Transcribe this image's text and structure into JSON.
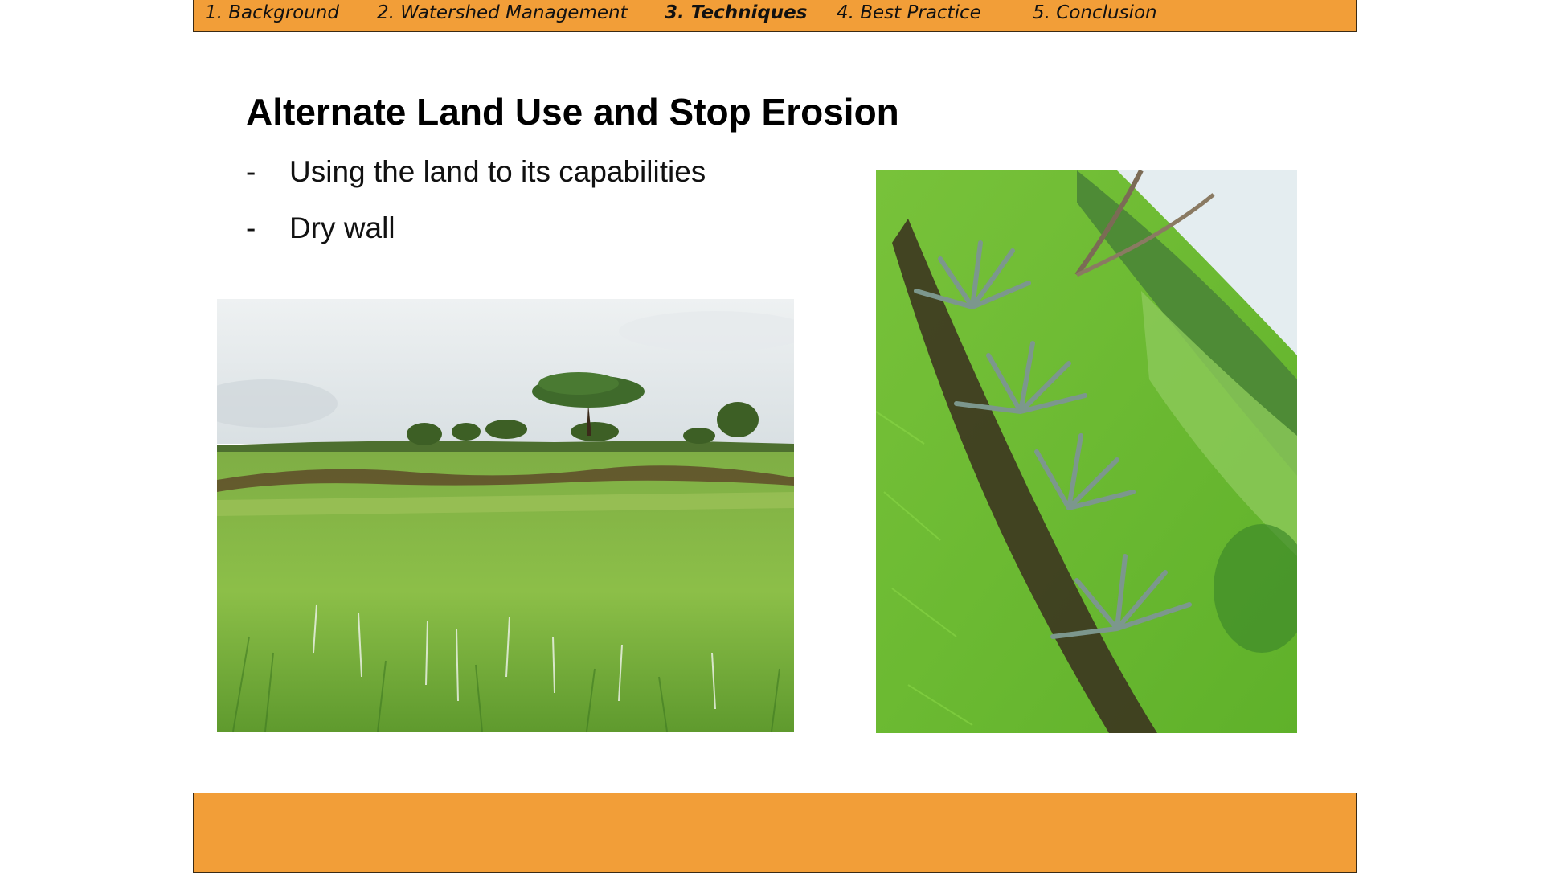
{
  "nav": {
    "items": [
      {
        "label": "1. Background"
      },
      {
        "label": "2. Watershed Management"
      },
      {
        "label": "3. Techniques",
        "active": true
      },
      {
        "label": "4. Best Practice"
      },
      {
        "label": "5. Conclusion"
      }
    ]
  },
  "slide": {
    "title": "Alternate Land Use and Stop Erosion",
    "bullets": [
      {
        "dash": "-",
        "text": "Using the land to its capabilities"
      },
      {
        "dash": "-",
        "text": "Dry wall"
      }
    ]
  },
  "colors": {
    "bar_fill": "#f29e38",
    "bar_border": "#3a2a14",
    "grass_light": "#8cc63a",
    "grass_dark": "#4f8a25",
    "sky": "#dfe6ea",
    "agave": "#6f8f86"
  }
}
